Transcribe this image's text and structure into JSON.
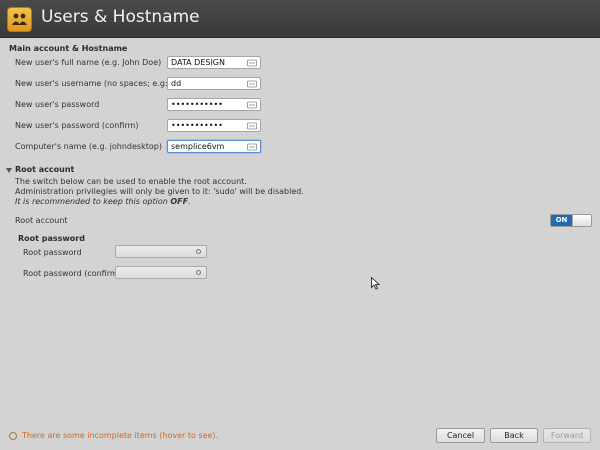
{
  "window": {
    "title": "Users & Hostname",
    "app_icon": "users-icon"
  },
  "main_account": {
    "section_title": "Main account & Hostname",
    "fields": [
      {
        "label": "New user's full name (e.g. John Doe)",
        "value": "DATA DESIGN"
      },
      {
        "label": "New user's username (no spaces; e.g: john)",
        "value": "dd"
      },
      {
        "label": "New user's password",
        "value": "•••••••••••"
      },
      {
        "label": "New user's password (confirm)",
        "value": "•••••••••••"
      },
      {
        "label": "Computer's name (e.g. johndesktop)",
        "value": "semplice6vm"
      }
    ]
  },
  "root_account": {
    "section_title": "Root account",
    "description_line1": "The switch below can be used to enable the root account.",
    "description_line2": "Administration privilegies will only be given to it: 'sudo' will be disabled.",
    "recommend_prefix": "It is recommended to keep this option ",
    "recommend_value": "OFF",
    "recommend_suffix": ".",
    "switch_label": "Root account",
    "switch_state": "ON",
    "password_title": "Root password",
    "password_fields": [
      {
        "label": "Root password",
        "value": ""
      },
      {
        "label": "Root password (confirm)",
        "value": ""
      }
    ]
  },
  "status": {
    "text": "There are some incomplete items (hover to see).",
    "color": "#d2691e"
  },
  "buttons": {
    "cancel": "Cancel",
    "back": "Back",
    "forward": "Forward"
  },
  "colors": {
    "accent": "#1f6db0",
    "titlebar": "#3f3f3f"
  }
}
